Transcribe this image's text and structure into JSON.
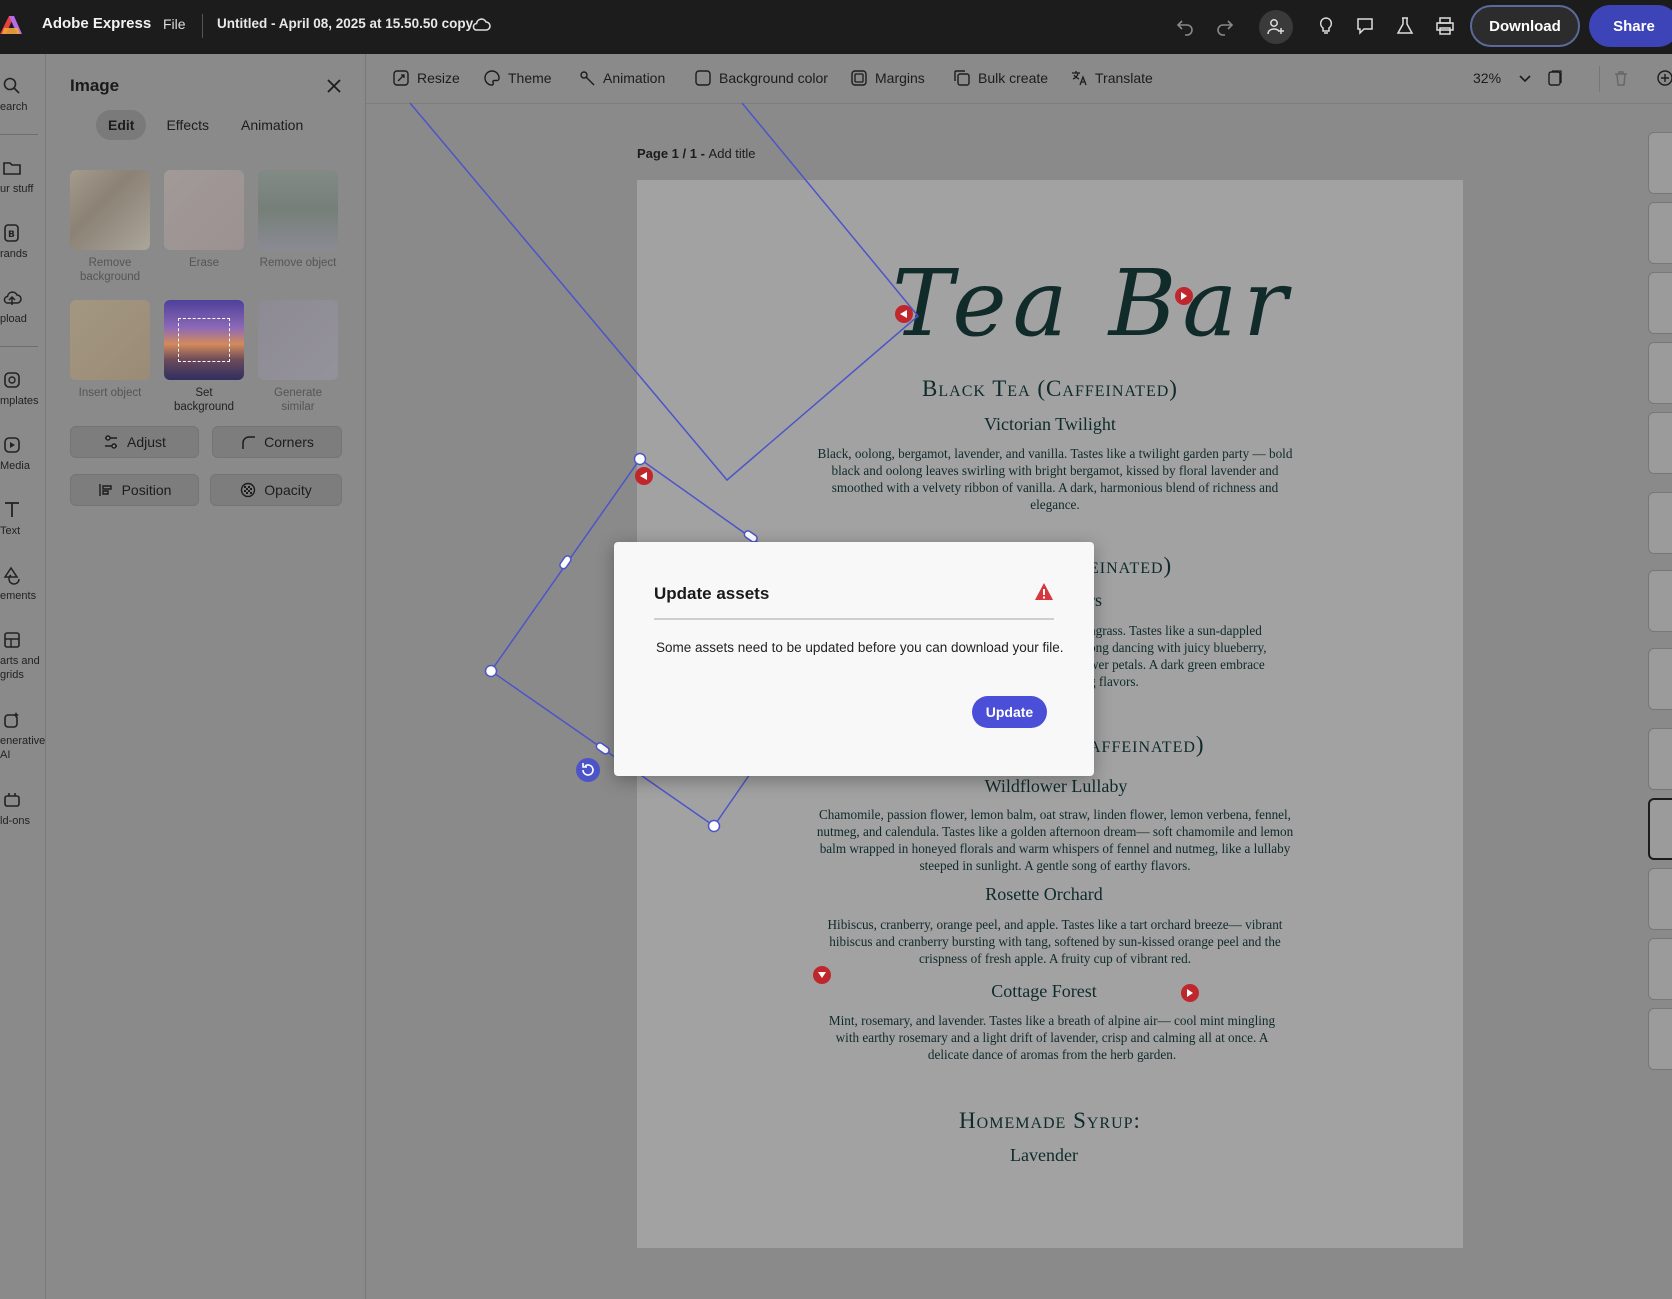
{
  "app": {
    "name": "Adobe Express",
    "file_menu": "File",
    "doc_title": "Untitled - April 08, 2025 at 15.50.50 copy",
    "download_label": "Download",
    "share_label": "Share"
  },
  "rail": [
    {
      "label": "earch",
      "icon": "search-icon"
    },
    {
      "label": "ur stuff",
      "icon": "folder-icon"
    },
    {
      "label": "rands",
      "icon": "brand-icon"
    },
    {
      "label": "pload",
      "icon": "upload-icon"
    },
    {
      "label": "mplates",
      "icon": "templates-icon"
    },
    {
      "label": "Media",
      "icon": "media-icon"
    },
    {
      "label": "Text",
      "icon": "text-icon"
    },
    {
      "label": "ements",
      "icon": "elements-icon"
    },
    {
      "label": "arts and\ngrids",
      "icon": "grid-icon"
    },
    {
      "label": "enerative\nAI",
      "icon": "ai-icon"
    },
    {
      "label": "ld-ons",
      "icon": "addons-icon"
    }
  ],
  "panel": {
    "title": "Image",
    "tabs": [
      "Edit",
      "Effects",
      "Animation"
    ],
    "tools": [
      {
        "label": "Remove background"
      },
      {
        "label": "Erase"
      },
      {
        "label": "Remove object"
      },
      {
        "label": "Insert object"
      },
      {
        "label": "Set background"
      },
      {
        "label": "Generate similar"
      }
    ],
    "buttons": [
      "Adjust",
      "Corners",
      "Position",
      "Opacity"
    ]
  },
  "toolbar": {
    "items": [
      "Resize",
      "Theme",
      "Animation",
      "Background color",
      "Margins",
      "Bulk create",
      "Translate"
    ],
    "zoom": "32%"
  },
  "page": {
    "label_prefix": "Page 1 / 1 - ",
    "label_action": "Add title"
  },
  "menu": {
    "brand": "Tea Bar",
    "sections": [
      {
        "title": "Black Tea (Caffeinated)"
      },
      {
        "title": "einated)"
      },
      {
        "title": "affeinated)"
      },
      {
        "title": "Homemade Syrup:"
      }
    ],
    "items": [
      {
        "name": "Victorian Twilight",
        "desc": "Black, oolong, bergamot, lavender, and vanilla. Tastes like a twilight garden party — bold black and oolong leaves swirling with bright bergamot, kissed by floral lavender and smoothed with a velvety ribbon of vanilla. A dark, harmonious blend of richness and elegance."
      },
      {
        "name": "rs",
        "desc": "ngrass. Tastes like a sun-dappled\nong dancing with juicy blueberry,\nwer petals. A dark green embrace\ng flavors."
      },
      {
        "name": "Wildflower Lullaby",
        "desc": "Chamomile, passion flower, lemon balm, oat straw, linden flower, lemon verbena, fennel, nutmeg, and calendula. Tastes like a golden afternoon dream— soft chamomile and lemon balm wrapped in honeyed florals and warm whispers of fennel and nutmeg, like a lullaby steeped in sunlight. A gentle song of earthy flavors."
      },
      {
        "name": "Rosette Orchard",
        "desc": "Hibiscus, cranberry, orange peel, and apple. Tastes like a tart orchard breeze— vibrant hibiscus and cranberry bursting with tang, softened by sun-kissed orange peel and the crispness of fresh apple. A fruity cup of vibrant red."
      },
      {
        "name": "Cottage Forest",
        "desc": "Mint, rosemary, and lavender. Tastes like a breath of alpine air— cool mint mingling with earthy rosemary and a light drift of lavender, crisp and calming all at once. A delicate dance of aromas from the herb garden."
      },
      {
        "name": "Lavender",
        "desc": ""
      }
    ]
  },
  "modal": {
    "title": "Update assets",
    "body": "Some assets need to be updated before you can download your file.",
    "button": "Update"
  },
  "colors": {
    "accent": "#4b4fd8",
    "share": "#3d44b8",
    "warning": "#d7373f",
    "selection": "#4c55c8"
  }
}
